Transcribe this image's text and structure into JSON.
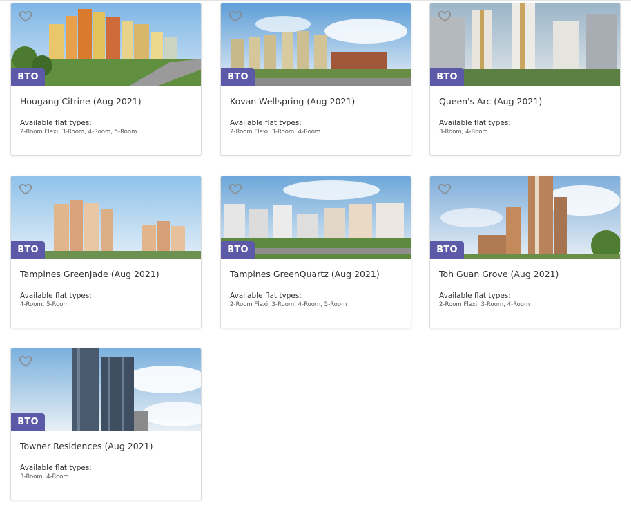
{
  "listings": [
    {
      "title": "Hougang Citrine (Aug 2021)",
      "badge": "BTO",
      "flat_types_label": "Available flat types:",
      "flat_types": "2-Room Flexi, 3-Room, 4-Room, 5-Room",
      "image_icon": "estate-photo"
    },
    {
      "title": "Kovan Wellspring (Aug 2021)",
      "badge": "BTO",
      "flat_types_label": "Available flat types:",
      "flat_types": "2-Room Flexi, 3-Room, 4-Room",
      "image_icon": "estate-photo"
    },
    {
      "title": "Queen's Arc (Aug 2021)",
      "badge": "BTO",
      "flat_types_label": "Available flat types:",
      "flat_types": "3-Room, 4-Room",
      "image_icon": "estate-photo"
    },
    {
      "title": "Tampines GreenJade (Aug 2021)",
      "badge": "BTO",
      "flat_types_label": "Available flat types:",
      "flat_types": "4-Room, 5-Room",
      "image_icon": "estate-photo"
    },
    {
      "title": "Tampines GreenQuartz (Aug 2021)",
      "badge": "BTO",
      "flat_types_label": "Available flat types:",
      "flat_types": "2-Room Flexi, 3-Room, 4-Room, 5-Room",
      "image_icon": "estate-photo"
    },
    {
      "title": "Toh Guan Grove (Aug 2021)",
      "badge": "BTO",
      "flat_types_label": "Available flat types:",
      "flat_types": "2-Room Flexi, 3-Room, 4-Room",
      "image_icon": "estate-photo"
    },
    {
      "title": "Towner Residences (Aug 2021)",
      "badge": "BTO",
      "flat_types_label": "Available flat types:",
      "flat_types": "3-Room, 4-Room",
      "image_icon": "estate-photo"
    }
  ],
  "colors": {
    "badge": "#5c5aa8",
    "heart": "#8a8a8a"
  }
}
